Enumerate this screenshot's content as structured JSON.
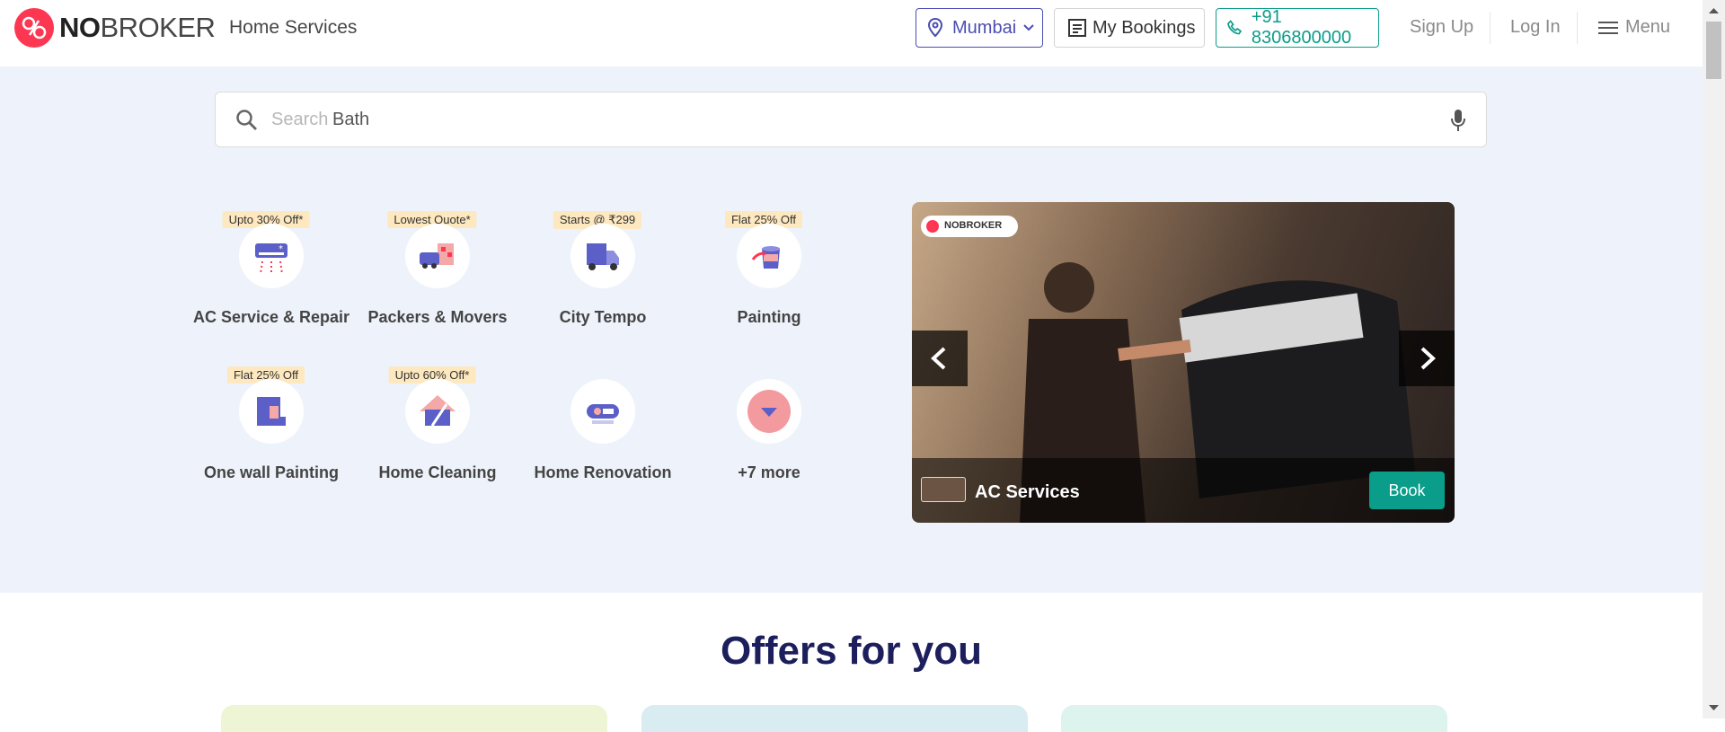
{
  "header": {
    "brand_bold": "NO",
    "brand_light": "BROKER",
    "subtitle": "Home Services",
    "city": "Mumbai",
    "my_bookings": "My Bookings",
    "phone": "+91 8306800000",
    "sign_up": "Sign Up",
    "log_in": "Log In",
    "menu": "Menu"
  },
  "search": {
    "prefix": "Search",
    "value": "Bath"
  },
  "services": [
    {
      "badge": "Upto 30% Off*",
      "label": "AC Service & Repair",
      "icon": "ac-icon"
    },
    {
      "badge": "Lowest Quote*",
      "label": "Packers & Movers",
      "icon": "truck-icon"
    },
    {
      "badge": "Starts @ ₹299",
      "label": "City Tempo",
      "icon": "tempo-icon"
    },
    {
      "badge": "Flat 25% Off",
      "label": "Painting",
      "icon": "paint-bucket-icon"
    },
    {
      "badge": "Flat 25% Off",
      "label": "One wall Painting",
      "icon": "wall-icon"
    },
    {
      "badge": "Upto 60% Off*",
      "label": "Home Cleaning",
      "icon": "cleaning-icon"
    },
    {
      "badge": "",
      "label": "Home Renovation",
      "icon": "renovation-icon"
    },
    {
      "badge": "",
      "label": "+7 more",
      "icon": "chevron-down-icon"
    }
  ],
  "carousel": {
    "caption": "AC Services",
    "book_label": "Book",
    "watermark": "NOBROKER"
  },
  "offers": {
    "title": "Offers for you"
  },
  "colors": {
    "brand_red": "#fd3752",
    "accent_blue": "#4b4db3",
    "accent_teal": "#0a9d8a",
    "hero_bg": "#eef3fb",
    "badge_bg": "#fde8bf"
  }
}
